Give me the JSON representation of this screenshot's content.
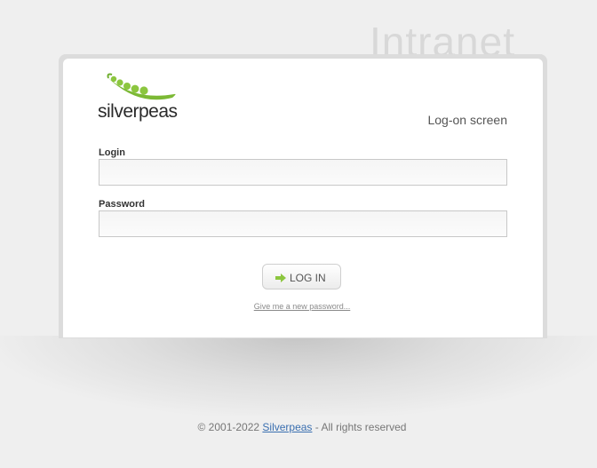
{
  "header": {
    "site_title": "Intranet"
  },
  "logo": {
    "text": "silverpeas",
    "accent_color": "#8cc63f"
  },
  "screen": {
    "label": "Log-on screen"
  },
  "form": {
    "login_label": "Login",
    "login_value": "",
    "password_label": "Password",
    "password_value": "",
    "submit_label": "LOG IN",
    "forgot_link": "Give me a new password..."
  },
  "footer": {
    "copyright": "© 2001-2022",
    "brand_link": "Silverpeas",
    "suffix": "- All rights reserved"
  },
  "colors": {
    "background": "#efefef",
    "panel": "#ffffff",
    "link": "#3a6fb0"
  }
}
